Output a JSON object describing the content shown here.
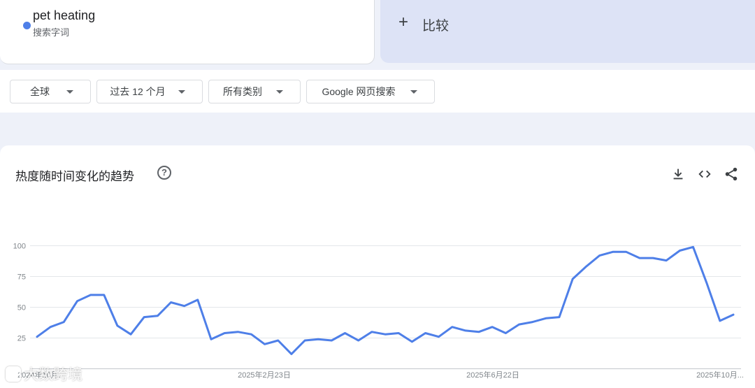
{
  "term": {
    "name": "pet heating",
    "type": "搜索字词",
    "color": "#4e7fe8"
  },
  "compare": {
    "label": "比较"
  },
  "filters": {
    "region": "全球",
    "period": "过去 12 个月",
    "category": "所有类别",
    "source": "Google 网页搜索"
  },
  "chart_header": {
    "title": "热度随时间变化的趋势",
    "help": "?"
  },
  "tools": [
    "download-icon",
    "embed-icon",
    "share-icon"
  ],
  "watermark": {
    "text": "大数跨境"
  },
  "chart_data": {
    "type": "line",
    "title": "热度随时间变化的趋势",
    "ylim": [
      0,
      100
    ],
    "y_ticks": [
      "25",
      "50",
      "75",
      "100"
    ],
    "x_tick_labels": [
      "2024年10月...",
      "2025年2月23日",
      "2025年6月22日",
      "2025年10月..."
    ],
    "grid": true,
    "series": [
      {
        "name": "pet heating",
        "color": "#4e7fe8",
        "values": [
          26,
          34,
          38,
          55,
          60,
          60,
          35,
          28,
          42,
          43,
          54,
          51,
          56,
          24,
          29,
          30,
          28,
          20,
          23,
          12,
          23,
          24,
          23,
          29,
          23,
          30,
          28,
          29,
          22,
          29,
          26,
          34,
          31,
          30,
          34,
          29,
          36,
          38,
          41,
          42,
          73,
          83,
          92,
          95,
          95,
          90,
          90,
          88,
          96,
          99,
          70,
          39,
          44
        ]
      }
    ]
  }
}
